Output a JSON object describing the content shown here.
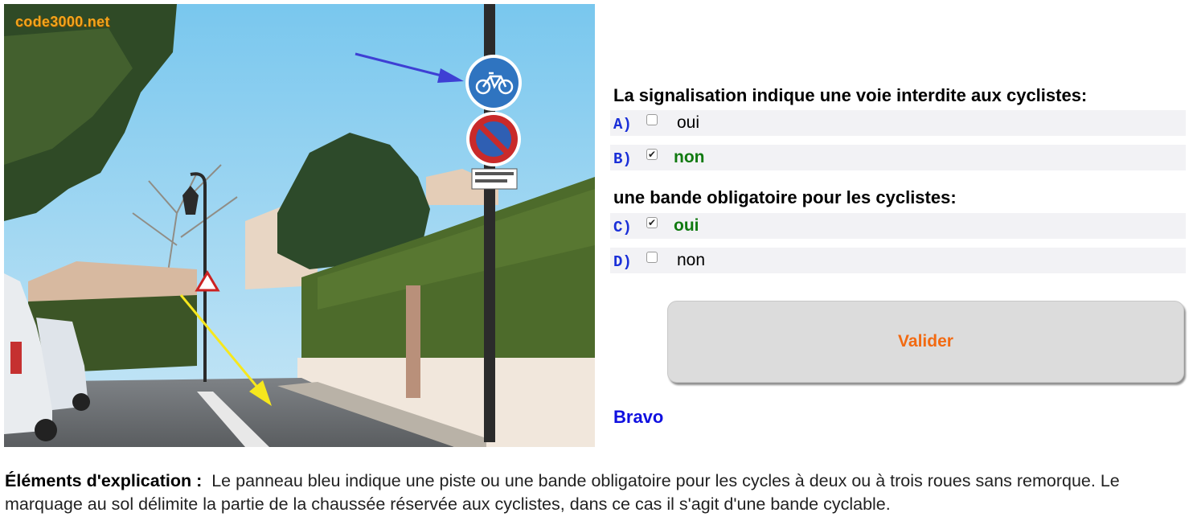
{
  "image": {
    "watermark": "code3000.net",
    "description_icons": [
      "arrow-blue-icon",
      "arrow-yellow-icon",
      "cycle-sign-icon",
      "no-parking-sign-icon"
    ]
  },
  "questions": [
    {
      "title": "La signalisation indique une voie interdite aux cyclistes:",
      "options": [
        {
          "letter": "A)",
          "checked": false,
          "label": "oui"
        },
        {
          "letter": "B)",
          "checked": true,
          "label": "non"
        }
      ]
    },
    {
      "title": "une bande obligatoire pour les cyclistes:",
      "options": [
        {
          "letter": "C)",
          "checked": true,
          "label": "oui"
        },
        {
          "letter": "D)",
          "checked": false,
          "label": "non"
        }
      ]
    }
  ],
  "submit_label": "Valider",
  "result": "Bravo",
  "explanation": {
    "heading": "Éléments d'explication :",
    "text": "Le panneau bleu indique une piste ou une bande obligatoire pour les cycles à deux ou à trois roues sans remorque. Le marquage au sol délimite la partie de la chaussée réservée aux cyclistes, dans ce cas il s'agit d'une bande cyclable."
  },
  "colors": {
    "letter": "#1a2fd8",
    "correct": "#117a11",
    "submit_text": "#f26a12",
    "result": "#1010e0"
  }
}
